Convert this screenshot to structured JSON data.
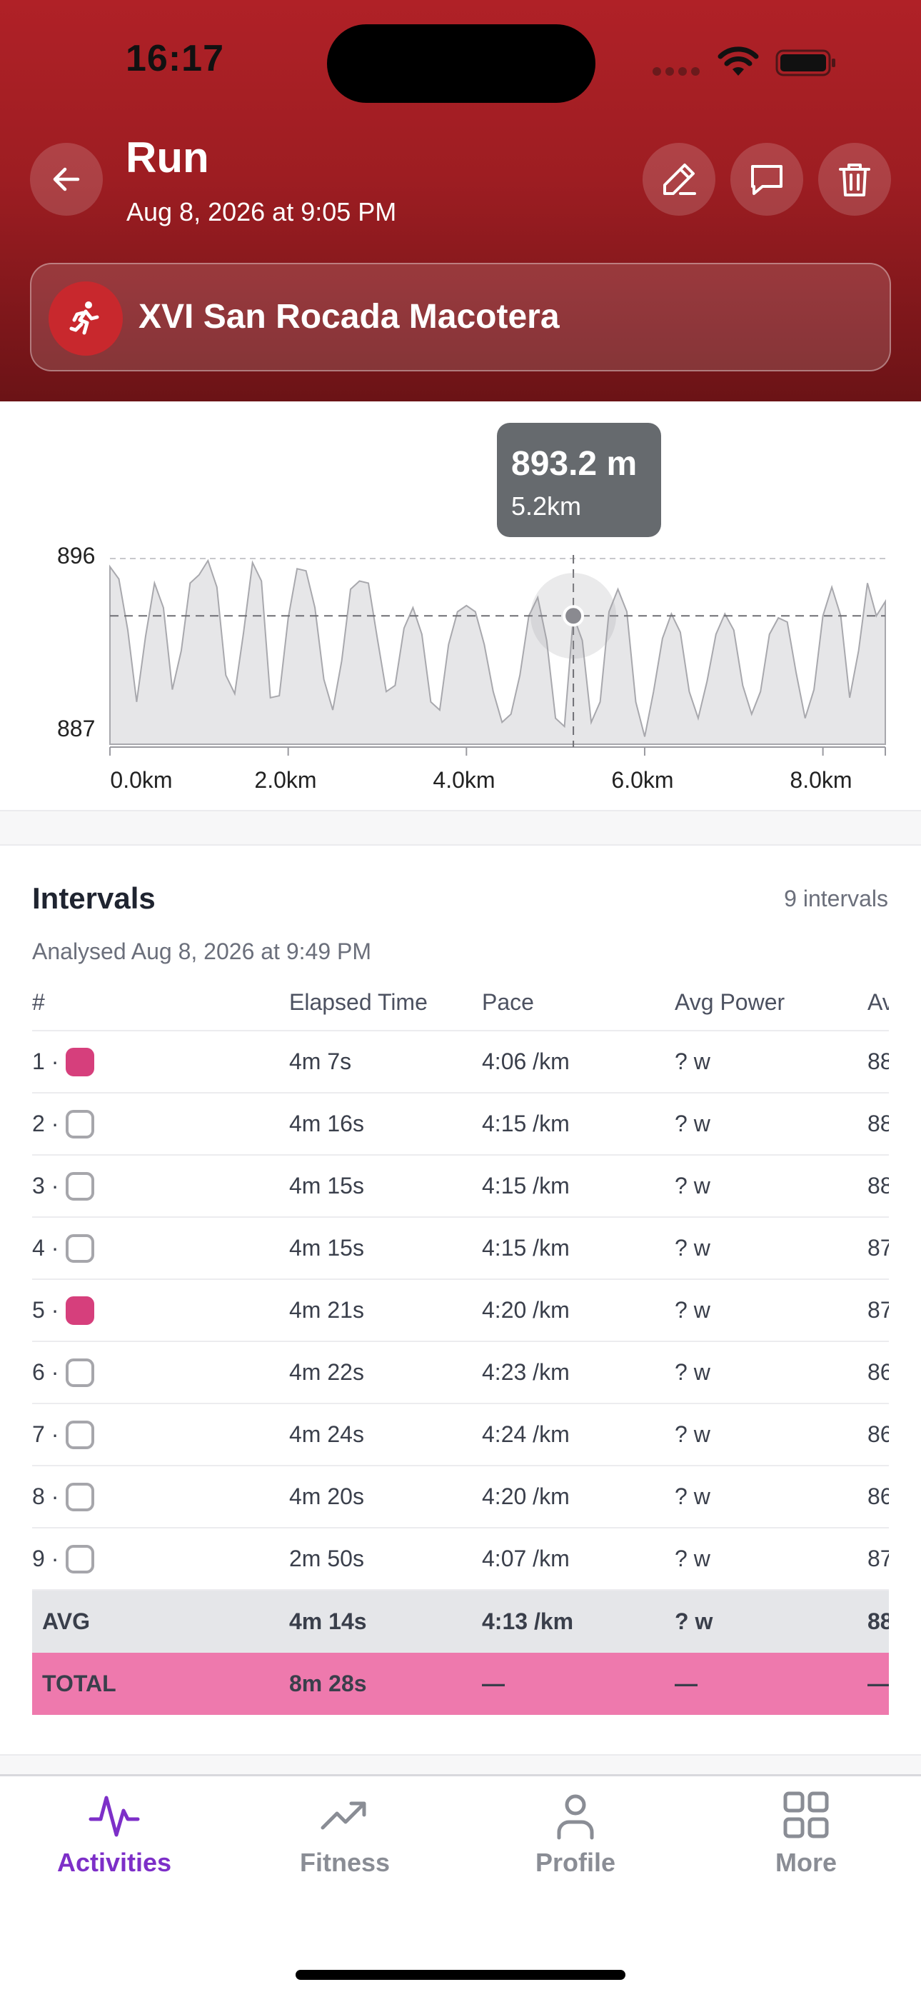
{
  "status": {
    "time": "16:17"
  },
  "header": {
    "title": "Run",
    "subtitle": "Aug 8, 2026 at 9:05 PM",
    "activity_name": "XVI San Rocada Macotera",
    "accent": "#b02127"
  },
  "chart": {
    "tooltip_value": "893.2 m",
    "tooltip_distance": "5.2km",
    "y_ticks": [
      "896",
      "887"
    ],
    "x_ticks": [
      "0.0km",
      "2.0km",
      "4.0km",
      "6.0km",
      "8.0km"
    ]
  },
  "chart_data": {
    "type": "area",
    "xlabel": "",
    "ylabel": "",
    "ylim": [
      887,
      896
    ],
    "xlim": [
      0,
      8.7
    ],
    "x_ticks": [
      0,
      2,
      4,
      6,
      8
    ],
    "y_ticks": [
      887,
      896
    ],
    "selected": {
      "x": 5.2,
      "y": 893.2
    },
    "series": [
      {
        "x": [
          0.0,
          0.1,
          0.2,
          0.3,
          0.4,
          0.5,
          0.6,
          0.7,
          0.8,
          0.9,
          1.0,
          1.1,
          1.2,
          1.3,
          1.4,
          1.5,
          1.6,
          1.7,
          1.8,
          1.9,
          2.0,
          2.1,
          2.2,
          2.3,
          2.4,
          2.5,
          2.6,
          2.7,
          2.8,
          2.9,
          3.0,
          3.1,
          3.2,
          3.3,
          3.4,
          3.5,
          3.6,
          3.7,
          3.8,
          3.9,
          4.0,
          4.1,
          4.2,
          4.3,
          4.4,
          4.5,
          4.6,
          4.7,
          4.8,
          4.9,
          5.0,
          5.1,
          5.2,
          5.3,
          5.4,
          5.5,
          5.6,
          5.7,
          5.8,
          5.9,
          6.0,
          6.1,
          6.2,
          6.3,
          6.4,
          6.5,
          6.6,
          6.7,
          6.8,
          6.9,
          7.0,
          7.1,
          7.2,
          7.3,
          7.4,
          7.5,
          7.6,
          7.7,
          7.8,
          7.9,
          8.0,
          8.1,
          8.2,
          8.3,
          8.4,
          8.5,
          8.6,
          8.7
        ],
        "values": [
          895.6,
          895.0,
          892.5,
          889.0,
          892.2,
          894.8,
          893.6,
          889.6,
          891.5,
          894.8,
          895.2,
          895.9,
          894.6,
          890.3,
          889.4,
          892.4,
          895.8,
          894.9,
          889.2,
          889.3,
          893.1,
          895.5,
          895.4,
          893.6,
          890.1,
          888.6,
          891.0,
          894.5,
          894.9,
          894.8,
          892.1,
          889.5,
          889.8,
          892.6,
          893.6,
          892.3,
          889.0,
          888.6,
          891.8,
          893.4,
          893.7,
          893.4,
          891.8,
          889.5,
          888.0,
          888.4,
          890.3,
          893.2,
          894.1,
          892.0,
          888.2,
          887.8,
          893.2,
          892.0,
          888.0,
          889.0,
          893.4,
          894.5,
          893.4,
          889.0,
          887.3,
          889.5,
          892.1,
          893.3,
          892.4,
          889.5,
          888.2,
          890.0,
          892.3,
          893.3,
          892.5,
          889.8,
          888.4,
          889.5,
          892.3,
          893.1,
          892.9,
          890.4,
          888.2,
          889.6,
          893.2,
          894.6,
          893.2,
          889.2,
          891.5,
          894.8,
          893.2,
          893.9
        ]
      }
    ]
  },
  "intervals": {
    "title": "Intervals",
    "count": "9 intervals",
    "analysed": "Analysed Aug 8, 2026 at 9:49 PM",
    "columns": [
      "#",
      "Elapsed Time",
      "Pace",
      "Avg Power",
      "Av"
    ],
    "rows": [
      {
        "num": "1 ·",
        "selected": true,
        "elapsed": "4m 7s",
        "pace": "4:06 /km",
        "power": "? w",
        "hr": "88"
      },
      {
        "num": "2 ·",
        "selected": false,
        "elapsed": "4m 16s",
        "pace": "4:15 /km",
        "power": "? w",
        "hr": "88"
      },
      {
        "num": "3 ·",
        "selected": false,
        "elapsed": "4m 15s",
        "pace": "4:15 /km",
        "power": "? w",
        "hr": "88"
      },
      {
        "num": "4 ·",
        "selected": false,
        "elapsed": "4m 15s",
        "pace": "4:15 /km",
        "power": "? w",
        "hr": "87"
      },
      {
        "num": "5 ·",
        "selected": true,
        "elapsed": "4m 21s",
        "pace": "4:20 /km",
        "power": "? w",
        "hr": "87"
      },
      {
        "num": "6 ·",
        "selected": false,
        "elapsed": "4m 22s",
        "pace": "4:23 /km",
        "power": "? w",
        "hr": "86"
      },
      {
        "num": "7 ·",
        "selected": false,
        "elapsed": "4m 24s",
        "pace": "4:24 /km",
        "power": "? w",
        "hr": "86"
      },
      {
        "num": "8 ·",
        "selected": false,
        "elapsed": "4m 20s",
        "pace": "4:20 /km",
        "power": "? w",
        "hr": "86"
      },
      {
        "num": "9 ·",
        "selected": false,
        "elapsed": "2m 50s",
        "pace": "4:07 /km",
        "power": "? w",
        "hr": "87"
      }
    ],
    "avg": {
      "label": "AVG",
      "elapsed": "4m 14s",
      "pace": "4:13 /km",
      "power": "? w",
      "hr": "88"
    },
    "total": {
      "label": "TOTAL",
      "elapsed": "8m 28s",
      "pace": "—",
      "power": "—",
      "hr": "—"
    },
    "selected_color": "#d63f7c"
  },
  "tabbar": {
    "active": "Activities",
    "active_color": "#7d2fc8",
    "tabs": [
      {
        "label": "Activities",
        "icon": "activity-pulse-icon"
      },
      {
        "label": "Fitness",
        "icon": "trend-up-icon"
      },
      {
        "label": "Profile",
        "icon": "person-icon"
      },
      {
        "label": "More",
        "icon": "grid-icon"
      }
    ]
  }
}
